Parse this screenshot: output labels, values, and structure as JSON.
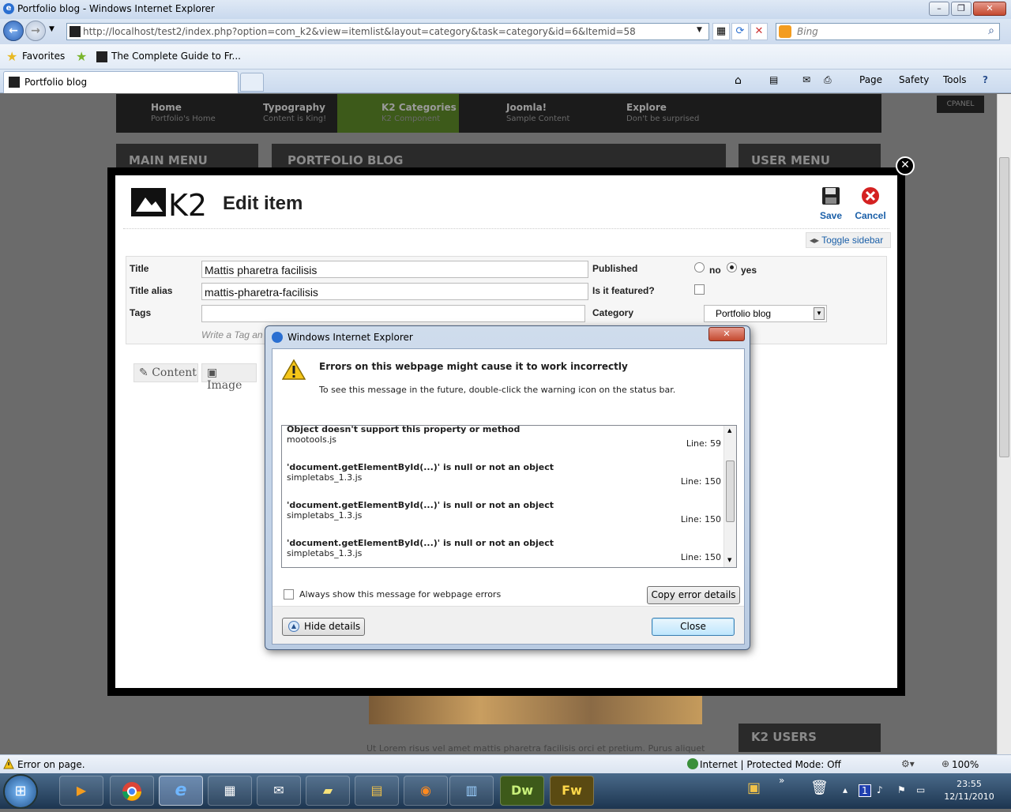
{
  "window": {
    "title": "Portfolio blog - Windows Internet Explorer"
  },
  "address": {
    "url": "http://localhost/test2/index.php?option=com_k2&view=itemlist&layout=category&task=category&id=6&Itemid=58",
    "search_placeholder": "Bing"
  },
  "favorites_bar": {
    "favorites_label": "Favorites",
    "link": "The Complete Guide to Fr..."
  },
  "tabs": [
    {
      "label": "Portfolio blog"
    }
  ],
  "command_bar": {
    "page": "Page",
    "safety": "Safety",
    "tools": "Tools"
  },
  "site": {
    "nav": [
      {
        "title": "Home",
        "sub": "Portfolio's Home"
      },
      {
        "title": "Typography",
        "sub": "Content is King!"
      },
      {
        "title": "K2 Categories",
        "sub": "K2 Component"
      },
      {
        "title": "Joomla!",
        "sub": "Sample Content"
      },
      {
        "title": "Explore",
        "sub": "Don't be surprised"
      }
    ],
    "cpanel": "CPANEL",
    "main_menu": "MAIN MENU",
    "portfolio_blog": "PORTFOLIO BLOG",
    "user_menu": "USER MENU",
    "k2_users": "K2 USERS",
    "lorem": "Ut Lorem risus vel amet mattis pharetra facilisis orci et pretium. Purus aliquet"
  },
  "edit_item": {
    "heading": "Edit item",
    "save": "Save",
    "cancel": "Cancel",
    "toggle_sidebar": "Toggle sidebar",
    "title_label": "Title",
    "title_value": "Mattis pharetra facilisis",
    "alias_label": "Title alias",
    "alias_value": "mattis-pharetra-facilisis",
    "tags_label": "Tags",
    "tags_hint": "Write a Tag an",
    "published_label": "Published",
    "no": "no",
    "yes": "yes",
    "featured_label": "Is it featured?",
    "category_label": "Category",
    "category_value": "Portfolio blog",
    "tab_content": "Content",
    "tab_image": "Image"
  },
  "dialog": {
    "title": "Windows Internet Explorer",
    "heading": "Errors on this webpage might cause it to work incorrectly",
    "sub": "To see this message in the future, double-click the warning icon on the status bar.",
    "errors": [
      {
        "message": "Object doesn't support this property or method",
        "file": "mootools.js",
        "line": "Line: 59"
      },
      {
        "message": "'document.getElementById(...)' is null or not an object",
        "file": "simpletabs_1.3.js",
        "line": "Line: 150"
      },
      {
        "message": "'document.getElementById(...)' is null or not an object",
        "file": "simpletabs_1.3.js",
        "line": "Line: 150"
      },
      {
        "message": "'document.getElementById(...)' is null or not an object",
        "file": "simpletabs_1.3.js",
        "line": "Line: 150"
      }
    ],
    "always_show": "Always show this message for webpage errors",
    "copy_button": "Copy error details",
    "hide_button": "Hide details",
    "close_button": "Close"
  },
  "status_bar": {
    "text": "Error on page.",
    "zone": "Internet | Protected Mode: Off",
    "zoom": "100%"
  },
  "taskbar": {
    "time": "23:55",
    "date": "12/11/2010",
    "dw": "Dw",
    "fw": "Fw"
  }
}
